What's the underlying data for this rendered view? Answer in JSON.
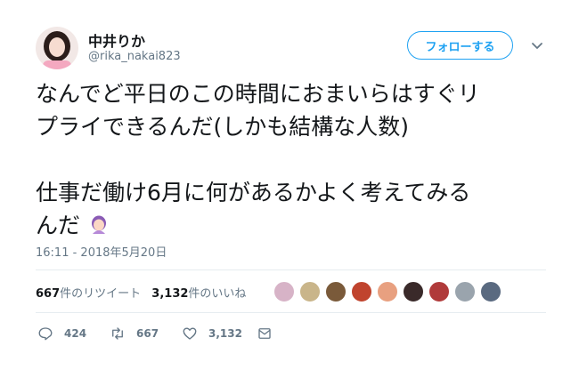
{
  "user": {
    "display_name": "中井りか",
    "handle": "@rika_nakai823",
    "avatar_icon": "profile-photo"
  },
  "follow_button": {
    "label": "フォローする",
    "color": "#1da1f2"
  },
  "tweet": {
    "lines_paragraph_1": [
      "なんでど平日のこの時間におまいらはすぐリ",
      "プライできるんだ(しかも結構な人数)"
    ],
    "lines_paragraph_2": [
      "仕事だ働け6月に何があるかよく考えてみる",
      "んだ"
    ],
    "emoji": "woman-facepalming"
  },
  "timestamp": "16:11 - 2018年5月20日",
  "stats": {
    "retweets_count": "667",
    "retweets_label": "件のリツイート",
    "likes_count": "3,132",
    "likes_label": "件のいいね"
  },
  "liker_avatars": [
    {
      "color": "#d7b3c7"
    },
    {
      "color": "#c9b58a"
    },
    {
      "color": "#7a5a3a"
    },
    {
      "color": "#c0442e"
    },
    {
      "color": "#e8a080"
    },
    {
      "color": "#3a2a2a"
    },
    {
      "color": "#b03a3a"
    },
    {
      "color": "#9aa4ad"
    },
    {
      "color": "#5a6a80"
    }
  ],
  "actions": {
    "reply_count": "424",
    "retweet_count": "667",
    "like_count": "3,132",
    "reply_icon": "reply-icon",
    "retweet_icon": "retweet-icon",
    "like_icon": "heart-icon",
    "dm_icon": "envelope-icon"
  }
}
